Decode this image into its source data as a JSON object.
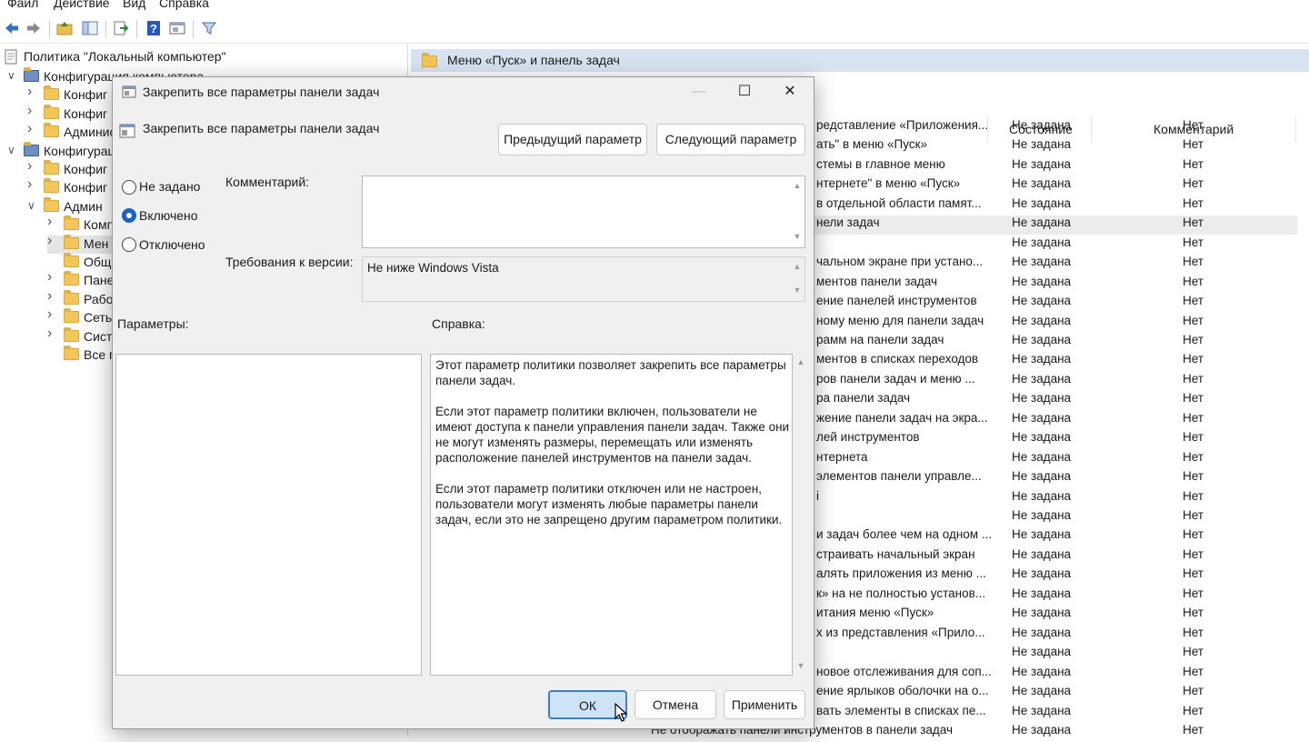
{
  "menu": [
    "Файл",
    "Действие",
    "Вид",
    "Справка"
  ],
  "toolbar": {
    "icons": [
      "back-icon",
      "forward-icon",
      "up-folder-icon",
      "show-hide-tree-icon",
      "export-icon",
      "help-icon",
      "properties-icon",
      "filter-icon"
    ]
  },
  "tree": {
    "root": "Политика \"Локальный компьютер\"",
    "items": [
      {
        "label": "Конфигурация компьютера",
        "indent": 0
      },
      {
        "label": "Конфиг",
        "indent": 1
      },
      {
        "label": "Конфиг",
        "indent": 1
      },
      {
        "label": "Админис",
        "indent": 1
      },
      {
        "label": "Конфигурац",
        "indent": 0
      },
      {
        "label": "Конфиг",
        "indent": 1
      },
      {
        "label": "Конфиг",
        "indent": 1
      },
      {
        "label": "Админ",
        "indent": 1
      },
      {
        "label": "Комп",
        "indent": 2
      },
      {
        "label": "Мен",
        "indent": 2
      },
      {
        "label": "Общ",
        "indent": 2
      },
      {
        "label": "Пане",
        "indent": 2
      },
      {
        "label": "Рабо",
        "indent": 2
      },
      {
        "label": "Сеть",
        "indent": 2
      },
      {
        "label": "Систе",
        "indent": 2
      },
      {
        "label": "Все п",
        "indent": 2
      }
    ]
  },
  "right_pane": {
    "title": "Меню «Пуск» и панель задач",
    "columns": {
      "state": "Состояние",
      "comment": "Комментарий"
    },
    "rows": [
      {
        "name": "редставление «Приложения...",
        "state": "Не задана",
        "comment": "Нет"
      },
      {
        "name": "ать\" в меню «Пуск»",
        "state": "Не задана",
        "comment": "Нет"
      },
      {
        "name": "стемы в главное меню",
        "state": "Не задана",
        "comment": "Нет"
      },
      {
        "name": "нтернете\" в меню «Пуск»",
        "state": "Не задана",
        "comment": "Нет"
      },
      {
        "name": "в отдельной области памят...",
        "state": "Не задана",
        "comment": "Нет"
      },
      {
        "name": "нели задач",
        "state": "Не задана",
        "comment": "Нет"
      },
      {
        "name": "",
        "state": "Не задана",
        "comment": "Нет"
      },
      {
        "name": "чальном экране при устано...",
        "state": "Не задана",
        "comment": "Нет"
      },
      {
        "name": "ментов панели задач",
        "state": "Не задана",
        "comment": "Нет"
      },
      {
        "name": "ение панелей инструментов",
        "state": "Не задана",
        "comment": "Нет"
      },
      {
        "name": "ному меню для панели задач",
        "state": "Не задана",
        "comment": "Нет"
      },
      {
        "name": "рамм на панели задач",
        "state": "Не задана",
        "comment": "Нет"
      },
      {
        "name": "ментов в списках переходов",
        "state": "Не задана",
        "comment": "Нет"
      },
      {
        "name": "ров панели задач и меню ...",
        "state": "Не задана",
        "comment": "Нет"
      },
      {
        "name": "ра панели задач",
        "state": "Не задана",
        "comment": "Нет"
      },
      {
        "name": "жение панели задач на экра...",
        "state": "Не задана",
        "comment": "Нет"
      },
      {
        "name": "лей инструментов",
        "state": "Не задана",
        "comment": "Нет"
      },
      {
        "name": "нтернета",
        "state": "Не задана",
        "comment": "Нет"
      },
      {
        "name": "элементов панели управле...",
        "state": "Не задана",
        "comment": "Нет"
      },
      {
        "name": "і",
        "state": "Не задана",
        "comment": "Нет"
      },
      {
        "name": "",
        "state": "Не задана",
        "comment": "Нет"
      },
      {
        "name": "и задач более чем на одном ...",
        "state": "Не задана",
        "comment": "Нет"
      },
      {
        "name": "страивать начальный экран",
        "state": "Не задана",
        "comment": "Нет"
      },
      {
        "name": "алять приложения из меню ...",
        "state": "Не задана",
        "comment": "Нет"
      },
      {
        "name": "к» на не полностью установ...",
        "state": "Не задана",
        "comment": "Нет"
      },
      {
        "name": "итания меню «Пуск»",
        "state": "Не задана",
        "comment": "Нет"
      },
      {
        "name": "х из представления «Прило...",
        "state": "Не задана",
        "comment": "Нет"
      },
      {
        "name": "",
        "state": "Не задана",
        "comment": "Нет"
      },
      {
        "name": "новое отслеживания для соп...",
        "state": "Не задана",
        "comment": "Нет"
      },
      {
        "name": "ение ярлыков оболочки на о...",
        "state": "Не задана",
        "comment": "Нет"
      },
      {
        "name": "вать элементы в списках пе...",
        "state": "Не задана",
        "comment": "Нет"
      },
      {
        "name": "Не отображать панели инструментов в панели задач",
        "state": "Не задана",
        "comment": "Нет"
      }
    ]
  },
  "dialog": {
    "title": "Закрепить все параметры панели задач",
    "heading": "Закрепить все параметры панели задач",
    "prev_button": "Предыдущий параметр",
    "next_button": "Следующий параметр",
    "radios": [
      {
        "label": "Не задано",
        "checked": false
      },
      {
        "label": "Включено",
        "checked": true
      },
      {
        "label": "Отключено",
        "checked": false
      }
    ],
    "comment_label": "Комментарий:",
    "comment_value": "",
    "version_label": "Требования к версии:",
    "version_value": "Не ниже Windows Vista",
    "params_label": "Параметры:",
    "help_label": "Справка:",
    "help_text": "Этот параметр политики позволяет закрепить все параметры панели задач.\n\nЕсли этот параметр политики включен, пользователи не имеют доступа к панели управления панели задач. Также они не могут изменять размеры, перемещать или изменять расположение панелей инструментов на панели задач.\n\nЕсли этот параметр политики отключен или не настроен, пользователи могут изменять любые параметры панели задач, если это не запрещено другим параметром политики.",
    "ok_button": "ОК",
    "cancel_button": "Отмена",
    "apply_button": "Применить"
  },
  "colors": {
    "accent": "#1a63c3",
    "header_band": "#d7e3f1",
    "folder": "#f2c759",
    "dialog_bg": "#f0f0f0"
  }
}
